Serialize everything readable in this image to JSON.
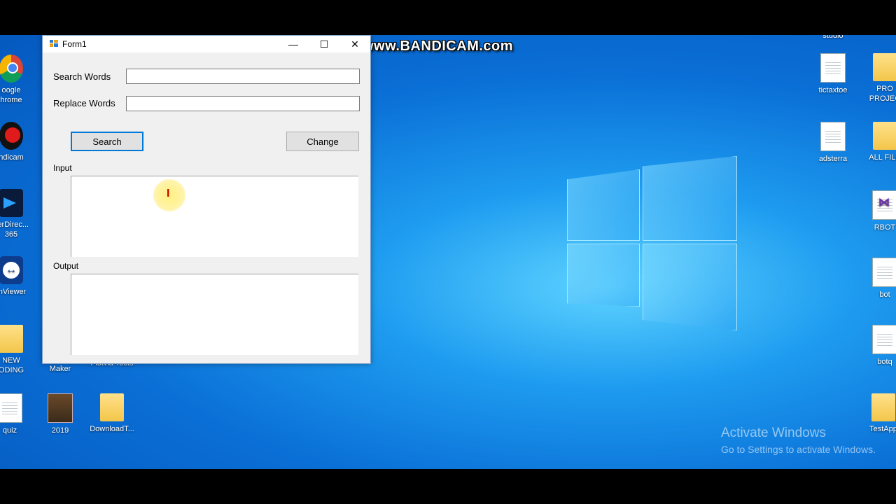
{
  "watermark": "www.BANDICAM.com",
  "window": {
    "title": "Form1",
    "minimize_glyph": "—",
    "maximize_glyph": "☐",
    "close_glyph": "✕",
    "search_words_label": "Search Words",
    "search_words_value": "",
    "replace_words_label": "Replace Words",
    "replace_words_value": "",
    "search_button": "Search",
    "change_button": "Change",
    "input_label": "Input",
    "output_label": "Output"
  },
  "desktop_icons_left": [
    {
      "label": "oogle\nhrome",
      "icon": "chrome-icon"
    },
    {
      "label": "ndicam",
      "icon": "bandicam-icon"
    },
    {
      "label": "verDirec...\n365",
      "icon": "powerdirector-icon"
    },
    {
      "label": "mViewer",
      "icon": "teamviewer-icon"
    },
    {
      "label": "NEW\nODING",
      "icon": "folder-icon"
    },
    {
      "label": "quiz",
      "icon": "file-icon"
    }
  ],
  "desktop_icons_bottom": [
    {
      "label": "Win Movie\nMaker",
      "icon": "movie-maker-icon"
    },
    {
      "label": "Flotvia Tools",
      "icon": "tools-icon"
    },
    {
      "label": "2019",
      "icon": "archive-icon"
    },
    {
      "label": "DownloadT...",
      "icon": "folder-icon"
    }
  ],
  "desktop_icons_right": [
    {
      "label": "studio",
      "icon": "file-icon"
    },
    {
      "label": "tictaxtoe",
      "icon": "file-icon"
    },
    {
      "label": "PRO\nPROJEC",
      "icon": "folder-icon"
    },
    {
      "label": "adsterra",
      "icon": "file-icon"
    },
    {
      "label": "ALL FILE",
      "icon": "folder-icon"
    },
    {
      "label": "RBOT",
      "icon": "visual-studio-icon"
    },
    {
      "label": "bot",
      "icon": "file-icon"
    },
    {
      "label": "botq",
      "icon": "file-icon"
    },
    {
      "label": "TestApp",
      "icon": "folder-icon"
    }
  ],
  "activation": {
    "line1": "Activate Windows",
    "line2": "Go to Settings to activate Windows."
  }
}
